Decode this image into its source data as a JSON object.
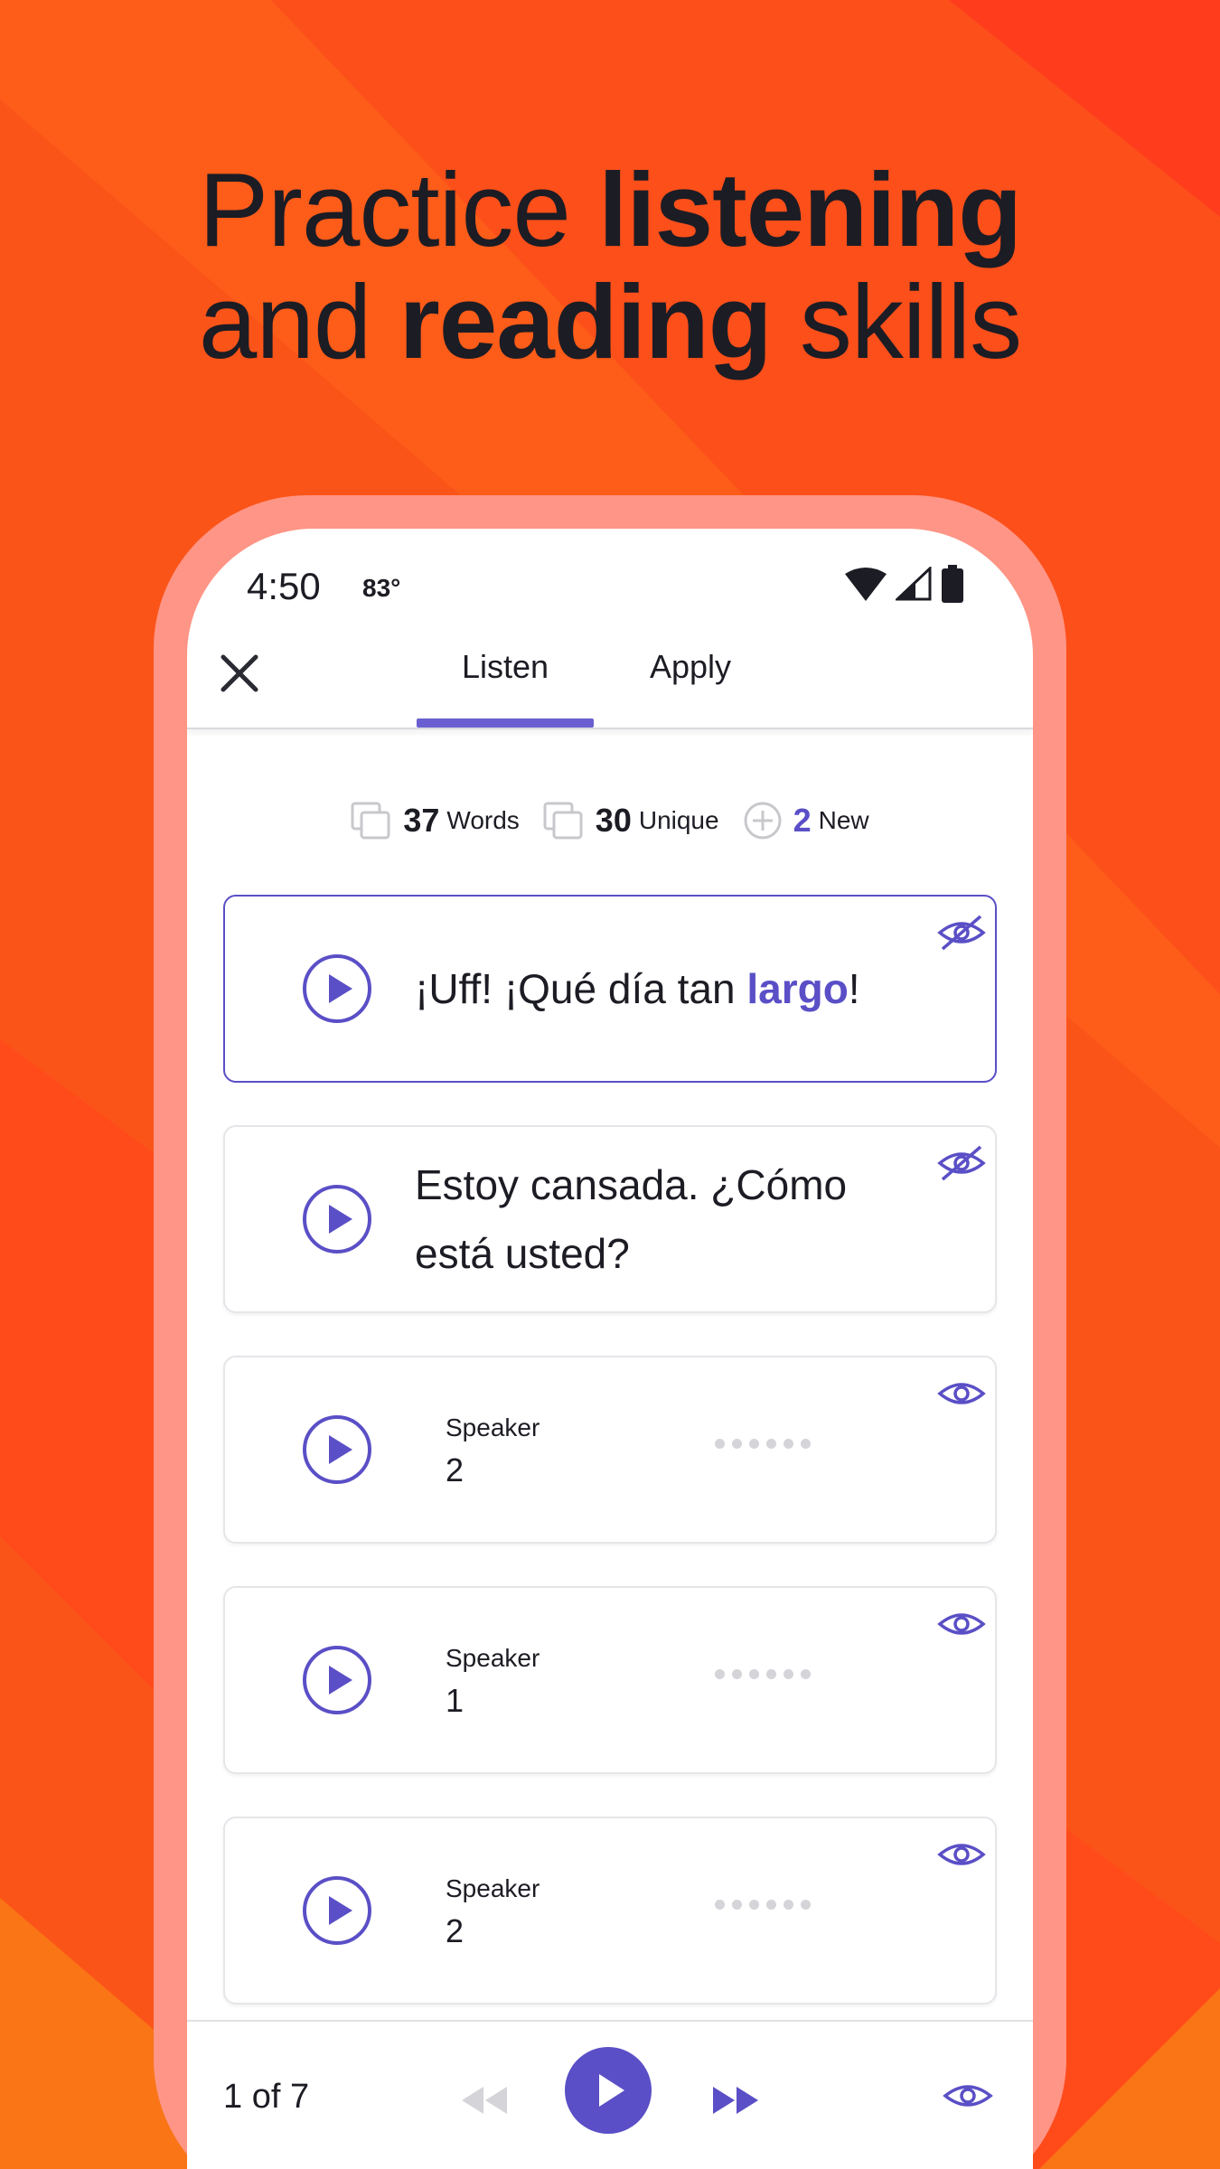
{
  "headline": {
    "line1_plain": "Practice ",
    "line1_bold": "listening",
    "line2_plain_a": "and ",
    "line2_bold": "reading",
    "line2_plain_b": " skills"
  },
  "status": {
    "time": "4:50",
    "temperature": "83°"
  },
  "tabs": [
    {
      "label": "Listen",
      "active": true
    },
    {
      "label": "Apply",
      "active": false
    }
  ],
  "stats": {
    "words": {
      "value": "37",
      "label": "Words"
    },
    "unique": {
      "value": "30",
      "label": "Unique"
    },
    "new": {
      "value": "2",
      "label": "New"
    }
  },
  "cards": [
    {
      "text_before": "¡Uff! ¡Qué día tan ",
      "highlight": "largo",
      "text_after": "!",
      "eye": "eye-slash-icon"
    },
    {
      "line1": "Estoy cansada. ¿Cómo",
      "line2": "está usted?",
      "eye": "eye-slash-icon"
    },
    {
      "speaker_label": "Speaker",
      "speaker_num": "2",
      "eye": "eye-icon"
    },
    {
      "speaker_label": "Speaker",
      "speaker_num": "1",
      "eye": "eye-icon"
    },
    {
      "speaker_label": "Speaker",
      "speaker_num": "2",
      "eye": "eye-icon"
    }
  ],
  "player": {
    "counter": "1 of 7"
  },
  "colors": {
    "accent": "#5a4fc6",
    "background": "#fb5418",
    "frame": "#ff9586"
  }
}
